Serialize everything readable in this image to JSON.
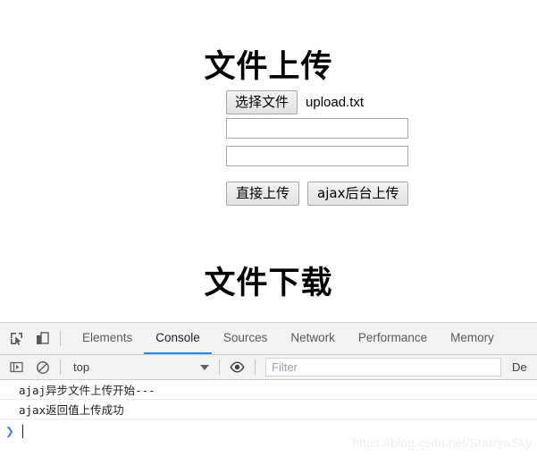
{
  "page": {
    "heading_upload": "文件上传",
    "heading_download": "文件下载",
    "file_chooser": {
      "button_label": "选择文件",
      "selected_file": "upload.txt",
      "icon": "file-input-icon"
    },
    "inputs": [
      {
        "name": "text-input-1",
        "value": "",
        "placeholder": ""
      },
      {
        "name": "text-input-2",
        "value": "",
        "placeholder": ""
      }
    ],
    "buttons": [
      {
        "name": "direct-upload-button",
        "label": "直接上传"
      },
      {
        "name": "ajax-upload-button",
        "label": "ajax后台上传"
      }
    ]
  },
  "devtools": {
    "tool_icons": [
      {
        "name": "inspect-element-icon",
        "title": "inspect-element"
      },
      {
        "name": "device-toolbar-icon",
        "title": "device-toolbar"
      }
    ],
    "tabs": [
      {
        "label": "Elements",
        "active": false
      },
      {
        "label": "Console",
        "active": true
      },
      {
        "label": "Sources",
        "active": false
      },
      {
        "label": "Network",
        "active": false
      },
      {
        "label": "Performance",
        "active": false
      },
      {
        "label": "Memory",
        "active": false
      }
    ],
    "active_tab_underline_color": "#1a8cff",
    "console_toolbar": {
      "sidebar_toggle_icon": "console-sidebar-icon",
      "clear_console_icon": "clear-console-icon",
      "context_selected": "top",
      "context_caret_icon": "chevron-down-icon",
      "live_expression_icon": "eye-icon",
      "filter_placeholder": "Filter",
      "filter_value": "",
      "levels_label": "De"
    },
    "console_messages": [
      {
        "text": "ajaj异步文件上传开始---",
        "level": "log"
      },
      {
        "text": "ajax返回值上传成功",
        "level": "log"
      }
    ],
    "prompt": {
      "arrow": "❯",
      "value": ""
    }
  },
  "watermark": {
    "text": "https://blog.csdn.net/StarryaSky"
  }
}
